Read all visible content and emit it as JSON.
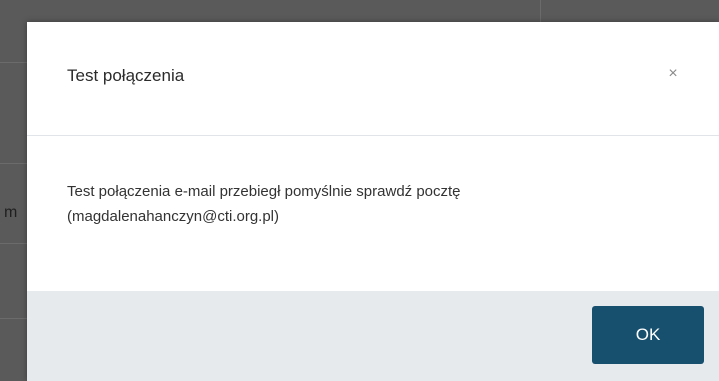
{
  "background": {
    "partial_text": "m"
  },
  "dialog": {
    "title": "Test połączenia",
    "close_symbol": "×",
    "message_line1": "Test połączenia e-mail przebiegł pomyślnie sprawdź pocztę",
    "message_line2": "(magdalenahanczyn@cti.org.pl)",
    "ok_label": "OK"
  },
  "colors": {
    "backdrop": "#5a5a5a",
    "footer": "#e6eaed",
    "primary_button": "#17506e"
  },
  "icons": {
    "close": "close-icon"
  }
}
